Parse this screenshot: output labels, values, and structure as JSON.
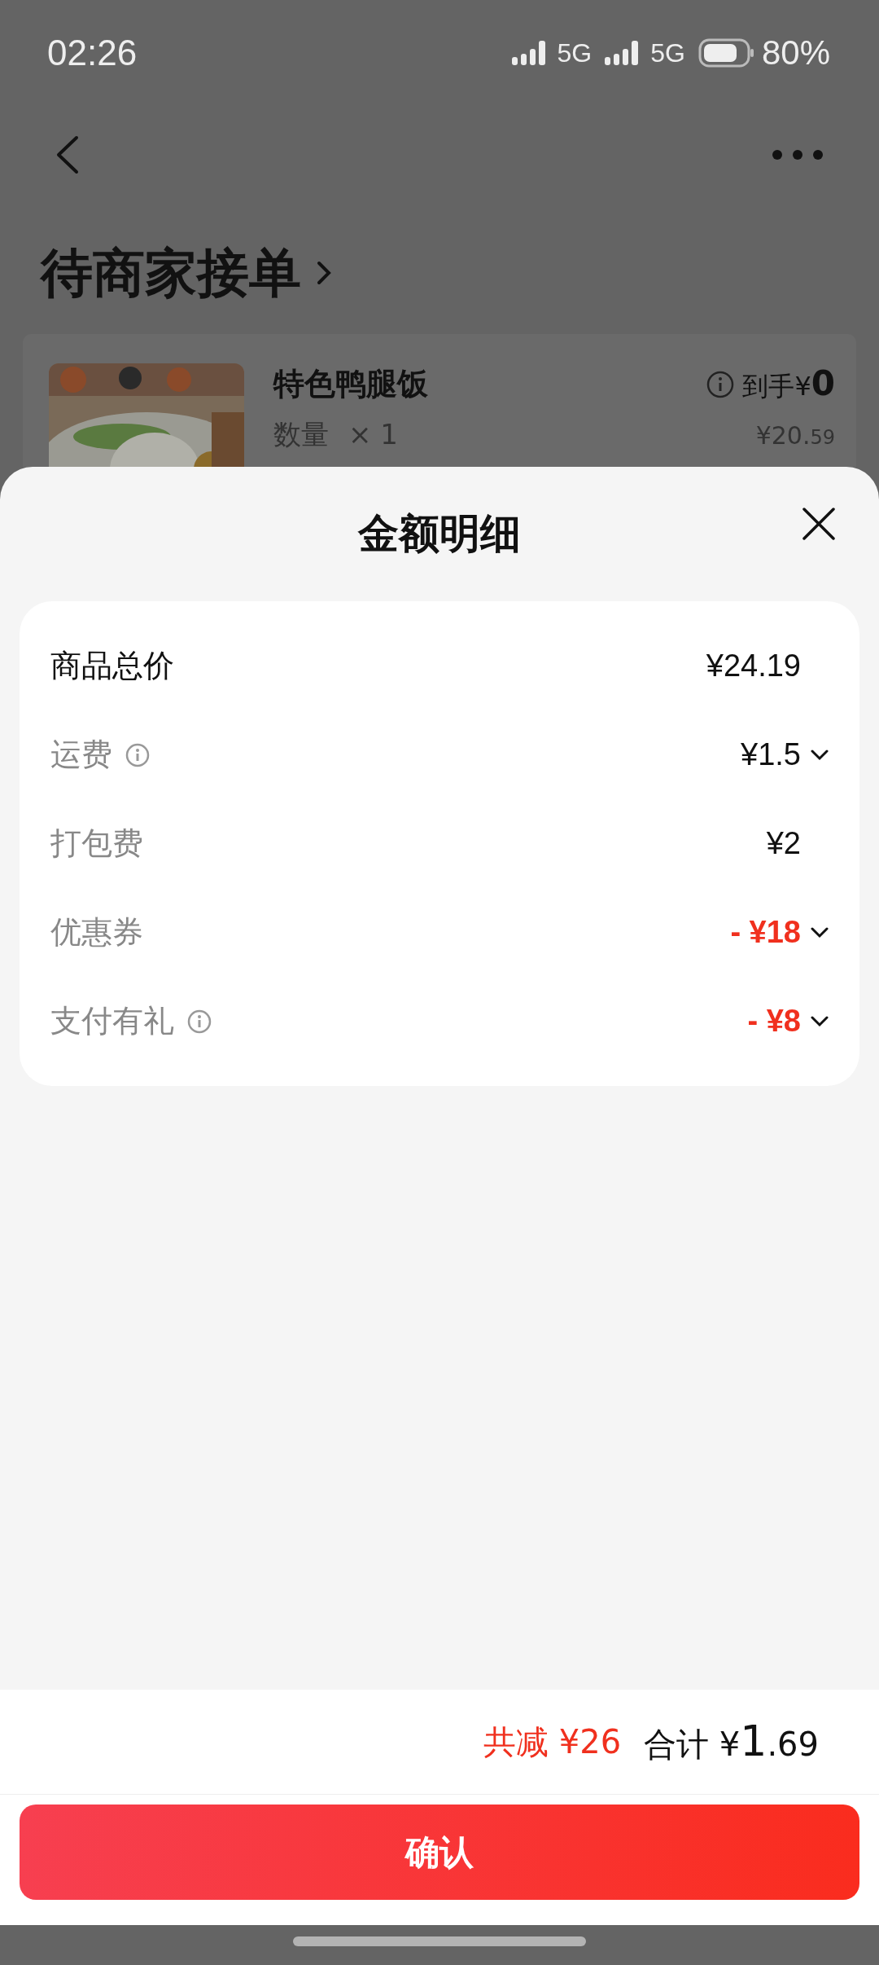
{
  "status_bar": {
    "time": "02:26",
    "network_1": "5G",
    "network_2": "5G",
    "battery": "80%"
  },
  "header": {
    "title": "待商家接单"
  },
  "order_item": {
    "kind": "picture",
    "name": "特色鸭腿饭",
    "quantity_label": "数量",
    "quantity": "× 1",
    "net_label": "到手¥",
    "net_amount": "0",
    "price_main": "¥20.",
    "price_fraction": "59"
  },
  "sheet": {
    "title": "金额明细",
    "rows": [
      {
        "kind": "total",
        "label": "商品总价",
        "info": false,
        "value": "¥24.19",
        "expandable": false
      },
      {
        "kind": "fee",
        "label": "运费",
        "info": true,
        "value": "¥1.5",
        "expandable": true
      },
      {
        "kind": "fee",
        "label": "打包费",
        "info": false,
        "value": "¥2",
        "expandable": false
      },
      {
        "kind": "discount",
        "label": "优惠券",
        "info": false,
        "value": "- ¥18",
        "expandable": true
      },
      {
        "kind": "discount",
        "label": "支付有礼",
        "info": true,
        "value": "- ¥8",
        "expandable": true
      }
    ]
  },
  "summary": {
    "discount": "共减 ¥26",
    "total_label": "合计",
    "total_currency": "¥",
    "total_main": "1",
    "total_fraction": ".69"
  },
  "confirm_button": "确认"
}
